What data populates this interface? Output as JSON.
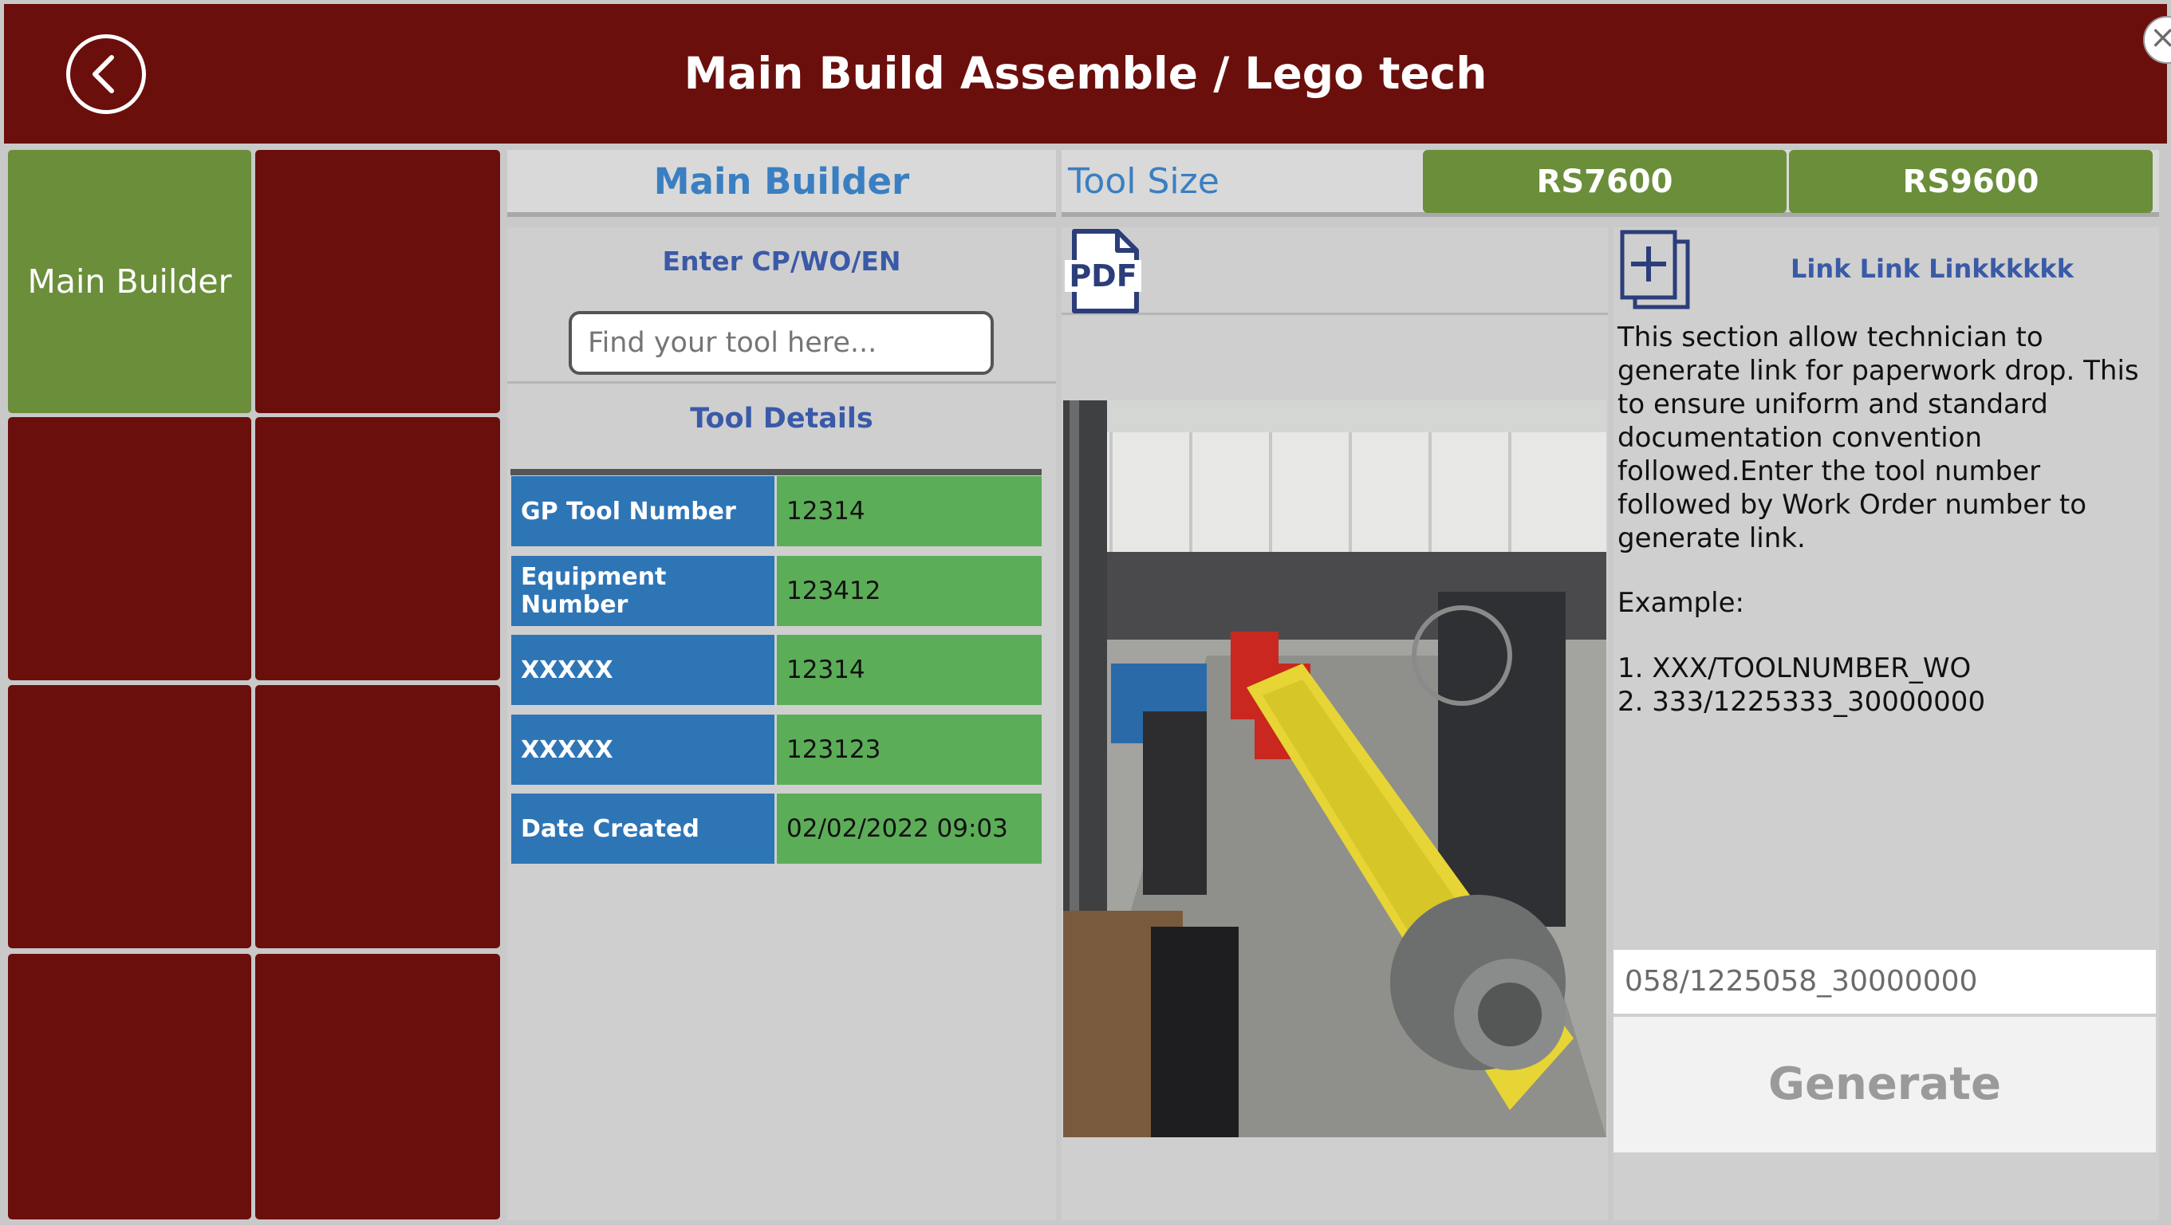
{
  "header": {
    "title": "Main Build Assemble / Lego tech"
  },
  "nav": {
    "active_tile_label": "Main Builder"
  },
  "topbar": {
    "section_label": "Main Builder",
    "tool_size_label": "Tool Size",
    "sizes": [
      "RS7600",
      "RS9600"
    ]
  },
  "search": {
    "label": "Enter CP/WO/EN",
    "placeholder": "Find your tool here..."
  },
  "details": {
    "title": "Tool Details",
    "rows": [
      {
        "label": "GP Tool Number",
        "value": "12314"
      },
      {
        "label": "Equipment Number",
        "value": "123412"
      },
      {
        "label": "XXXXX",
        "value": "12314"
      },
      {
        "label": "XXXXX",
        "value": "123123"
      },
      {
        "label": "Date Created",
        "value": "02/02/2022 09:03"
      }
    ]
  },
  "pdf": {
    "icon_text": "PDF"
  },
  "link": {
    "title": "Link Link Linkkkkkk",
    "description": "This section allow technician to generate link for paperwork drop. This to ensure uniform and standard documentation convention followed.Enter the tool number followed by Work Order number to generate link.",
    "example_label": "Example:",
    "examples": [
      "1. XXX/TOOLNUMBER_WO",
      "2. 333/1225333_30000000"
    ],
    "input_value": "058/1225058_30000000",
    "generate_label": "Generate"
  }
}
